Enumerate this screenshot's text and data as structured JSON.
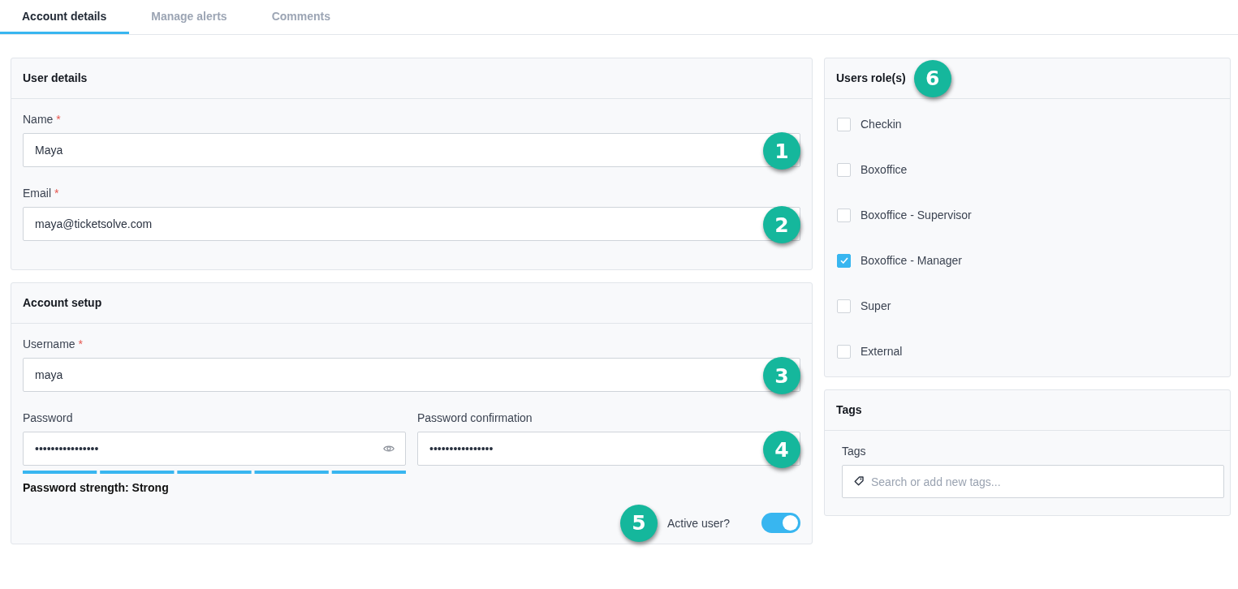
{
  "tabs": [
    {
      "label": "Account details",
      "selected": true
    },
    {
      "label": "Manage alerts",
      "selected": false
    },
    {
      "label": "Comments",
      "selected": false
    }
  ],
  "user_details": {
    "title": "User details",
    "fields": [
      {
        "label": "Name",
        "required_mark": "*",
        "value": "Maya",
        "callout": "1"
      },
      {
        "label": "Email",
        "required_mark": "*",
        "value": "maya@ticketsolve.com",
        "callout": "2"
      }
    ]
  },
  "account_setup": {
    "title": "Account setup",
    "username": {
      "label": "Username",
      "required_mark": "*",
      "value": "maya",
      "callout": "3"
    },
    "password": {
      "label": "Password",
      "value": "••••••••••••••••"
    },
    "password_strength": {
      "level": 1,
      "text": "Password strength: Strong"
    },
    "password_confirmation": {
      "label": "Password confirmation",
      "value": "••••••••••••••••",
      "callout": "4"
    },
    "active_user": {
      "label": "Active user?",
      "on": true,
      "callout": "5"
    }
  },
  "roles": {
    "title": "Users role(s)",
    "callout": "6",
    "items": [
      {
        "label": "Checkin",
        "checked": false
      },
      {
        "label": "Boxoffice",
        "checked": false
      },
      {
        "label": "Boxoffice - Supervisor",
        "checked": false
      },
      {
        "label": "Boxoffice - Manager",
        "checked": true
      },
      {
        "label": "Super",
        "checked": false
      },
      {
        "label": "External",
        "checked": false
      }
    ]
  },
  "tags": {
    "title": "Tags",
    "field": {
      "label": "Tags",
      "placeholder": "Search or add new tags..."
    }
  }
}
